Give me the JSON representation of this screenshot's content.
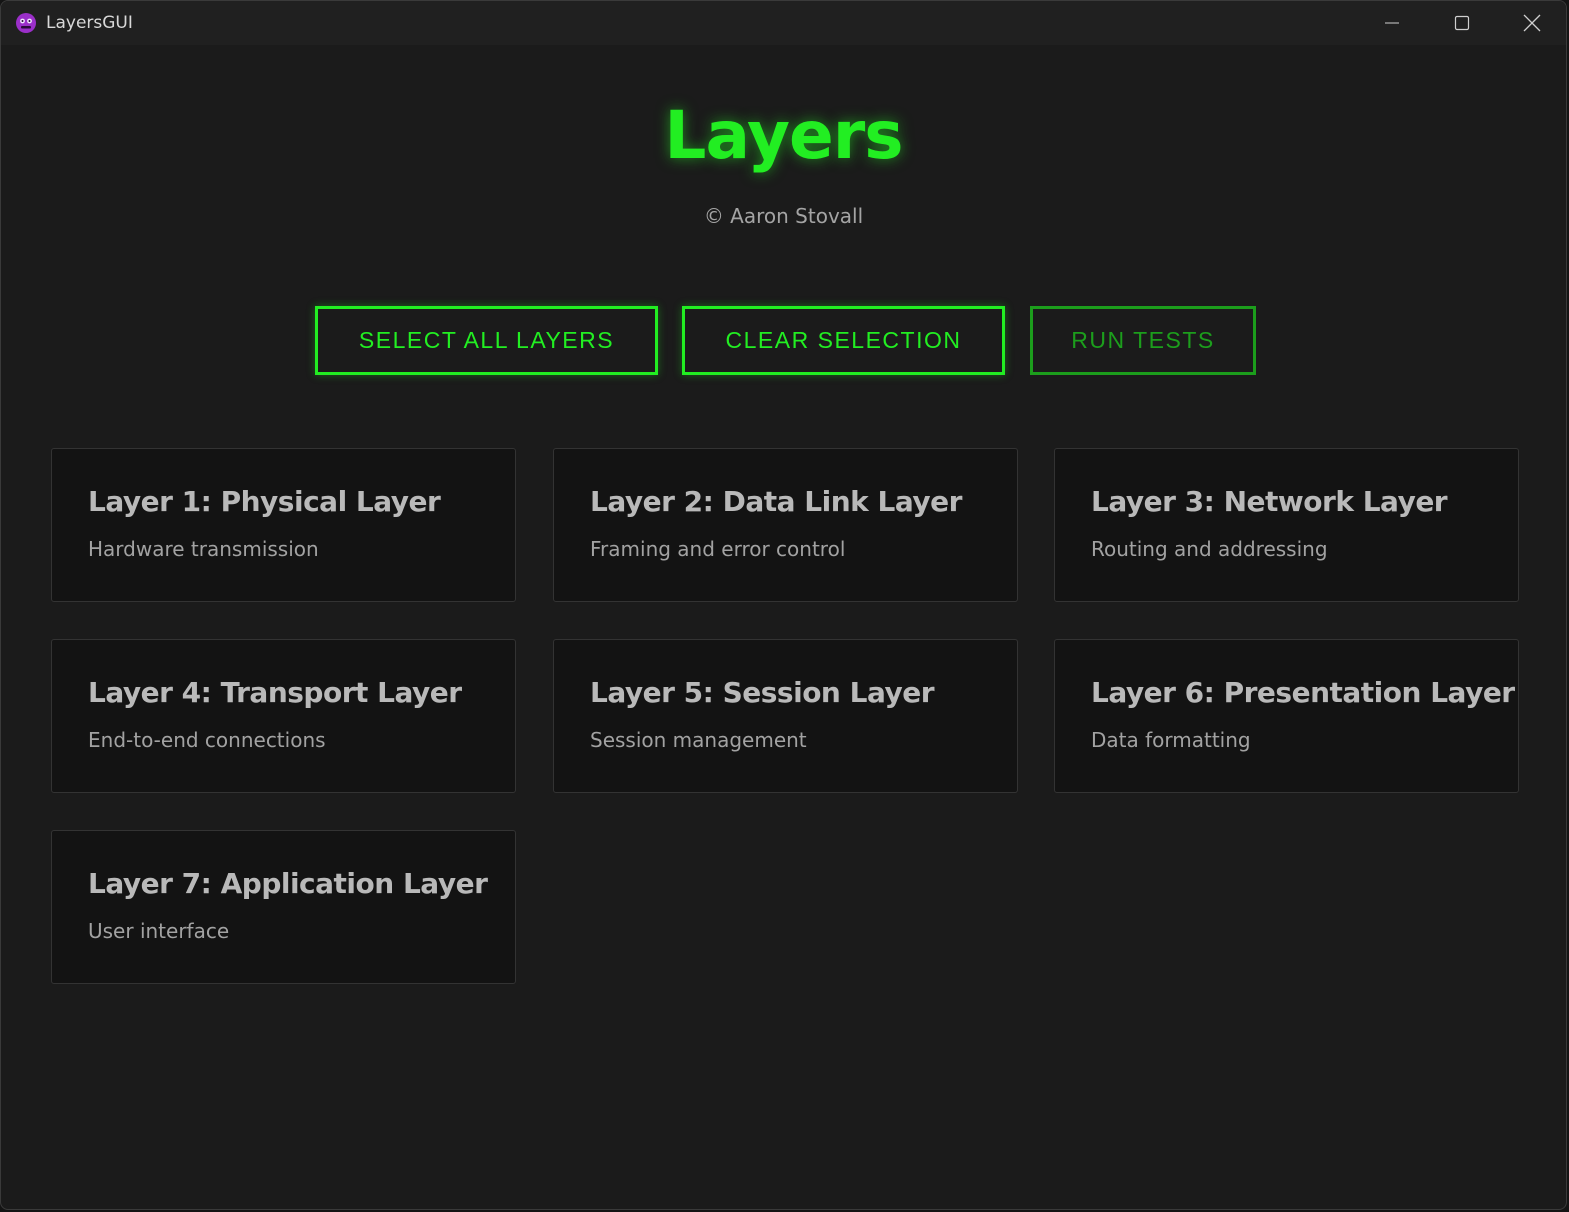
{
  "window": {
    "title": "LayersGUI",
    "icon": "alien-face-icon",
    "controls": [
      "minimize-icon",
      "maximize-icon",
      "close-icon"
    ]
  },
  "header": {
    "title": "Layers",
    "subtitle": "© Aaron Stovall"
  },
  "actions": {
    "select_all": "SELECT ALL LAYERS",
    "clear": "CLEAR SELECTION",
    "run_tests": "RUN TESTS"
  },
  "layers": [
    {
      "title": "Layer 1: Physical Layer",
      "description": "Hardware transmission"
    },
    {
      "title": "Layer 2: Data Link Layer",
      "description": "Framing and error control"
    },
    {
      "title": "Layer 3: Network Layer",
      "description": "Routing and addressing"
    },
    {
      "title": "Layer 4: Transport Layer",
      "description": "End-to-end connections"
    },
    {
      "title": "Layer 5: Session Layer",
      "description": "Session management"
    },
    {
      "title": "Layer 6: Presentation Layer",
      "description": "Data formatting"
    },
    {
      "title": "Layer 7: Application Layer",
      "description": "User interface"
    }
  ],
  "colors": {
    "accent": "#22ee22",
    "accent_dim": "#1c9e1c",
    "background": "#1b1b1b",
    "card": "#131313"
  }
}
